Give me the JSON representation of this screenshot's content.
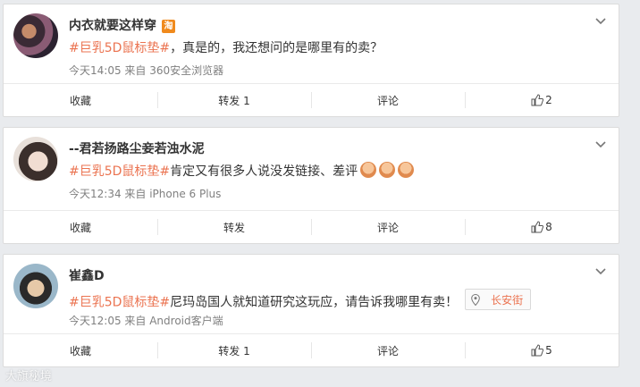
{
  "posts": [
    {
      "user": "内衣就要这样穿",
      "badge": "淘",
      "hashtag": "#巨乳5D鼠标垫#",
      "text": "，真是的，我还想问的是哪里有的卖？",
      "meta": "今天14:05 来自 360安全浏览器",
      "actions": {
        "collect": "收藏",
        "repost": "转发 1",
        "comment": "评论",
        "likes": "2"
      }
    },
    {
      "user": "--君若扬路尘妾若浊水泥",
      "hashtag": "#巨乳5D鼠标垫#",
      "text": "肯定又有很多人说没发链接、差评",
      "meta": "今天12:34 来自 iPhone 6 Plus",
      "actions": {
        "collect": "收藏",
        "repost": "转发",
        "comment": "评论",
        "likes": "8"
      }
    },
    {
      "user": "崔鑫D",
      "hashtag": "#巨乳5D鼠标垫#",
      "text": "尼玛岛国人就知道研究这玩应，请告诉我哪里有卖！",
      "location": "长安街",
      "meta": "今天12:05 来自 Android客户端",
      "actions": {
        "collect": "收藏",
        "repost": "转发 1",
        "comment": "评论",
        "likes": "5"
      }
    }
  ],
  "watermark": "大旗秘境",
  "icons": {
    "more": "chevron-down-icon",
    "like": "thumbs-up-icon",
    "location": "location-pin-icon",
    "emoji": "emoji-icon"
  },
  "colors": {
    "hashtag": "#eb7350",
    "meta": "#808080",
    "background": "#e9ebee"
  }
}
